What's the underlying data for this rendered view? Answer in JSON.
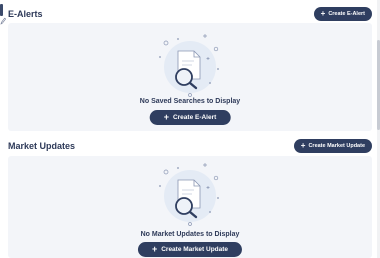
{
  "ealerts": {
    "title": "E-Alerts",
    "header_button": "Create E-Alert",
    "empty_title": "No Saved Searches to Display",
    "empty_button": "Create E-Alert"
  },
  "market_updates": {
    "title": "Market Updates",
    "header_button": "Create Market Update",
    "empty_title": "No Market Updates to Display",
    "empty_button": "Create Market Update"
  },
  "icons": {
    "plus": "+",
    "edit": "edit-icon",
    "empty_state": "document-search-icon"
  },
  "colors": {
    "primary_button": "#2f3e60",
    "panel_bg": "#f3f5f9",
    "text": "#2e3a59",
    "illustration_bg": "#e4ebf5"
  }
}
